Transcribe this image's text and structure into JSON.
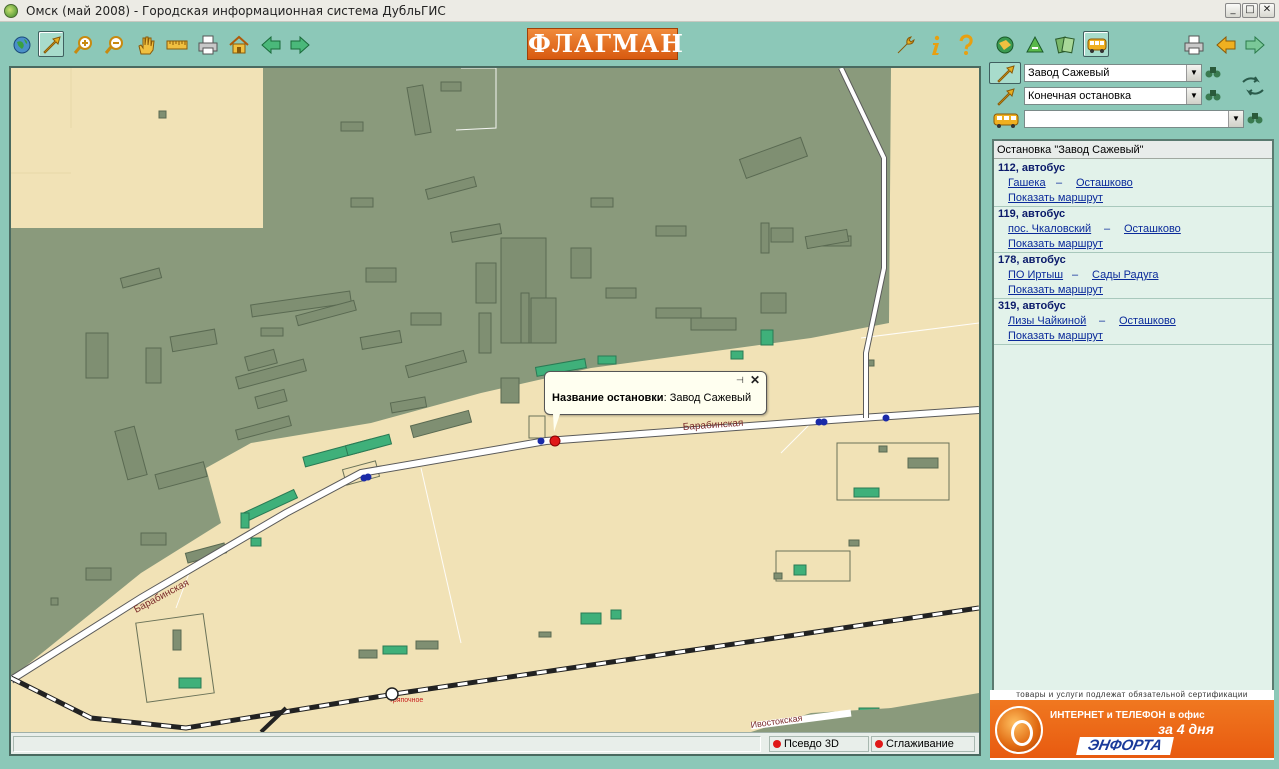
{
  "window": {
    "title": "Омск (май 2008) - Городская информационная система ДубльГИС",
    "minimize": "_",
    "maximize": "□",
    "close": "✕"
  },
  "toolbar": {
    "logo": "ФЛАГМАН",
    "left_tools": [
      "globe-icon",
      "select-arrow-icon",
      "zoom-in-icon",
      "zoom-out-icon",
      "pan-hand-icon",
      "ruler-icon",
      "print-icon",
      "home-icon",
      "back-arrow-icon",
      "forward-arrow-icon"
    ],
    "help_tools": [
      "wrench-icon",
      "info-icon",
      "help-icon"
    ],
    "mode_tools": [
      "city-search-icon",
      "address-search-icon",
      "organization-search-icon",
      "bus-route-icon"
    ],
    "right_tools": [
      "print-icon",
      "back-arrow-icon",
      "forward-arrow-icon"
    ]
  },
  "map": {
    "street_1": "Барабинская",
    "street_2": "Барабинская",
    "street_3": "Ивостокская",
    "station_label": "Тряпочное"
  },
  "popup": {
    "label": "Название остановки",
    "value": "Завод Сажевый",
    "pin": "⊣",
    "close": "✕"
  },
  "status": {
    "field": "",
    "pseudo3d": "Псевдо 3D",
    "smoothing": "Сглаживание"
  },
  "route_search": {
    "from": "Завод Сажевый",
    "to": "Конечная остановка",
    "transport": ""
  },
  "results": {
    "header": "Остановка \"Завод Сажевый\"",
    "show_label": "Показать маршрут",
    "routes": [
      {
        "title": "112, автобус",
        "from": "Гашека",
        "to": "Осташково"
      },
      {
        "title": "119, автобус",
        "from": "пос. Чкаловский",
        "to": "Осташково"
      },
      {
        "title": "178, автобус",
        "from": "ПО Иртыш",
        "to": "Сады Радуга"
      },
      {
        "title": "319, автобус",
        "from": "Лизы Чайкиной",
        "to": "Осташково"
      }
    ]
  },
  "ad": {
    "certification": "товары и услуги подлежат обязательной сертификации",
    "line1": "ИНТЕРНЕТ и ТЕЛЕФОН",
    "line1_small": "в офис",
    "line2": "за 4 дня",
    "brand": "ЭНФОРТА"
  },
  "colors": {
    "ui_background": "#8cc8b8",
    "map_ground": "#f1e2b6",
    "industrial_zone": "#8a9a7c",
    "road": "#ffffff",
    "stop_selected": "#e01818",
    "stop": "#1a2aa8",
    "link": "#0a2a9a",
    "logo": "#e8701e"
  }
}
